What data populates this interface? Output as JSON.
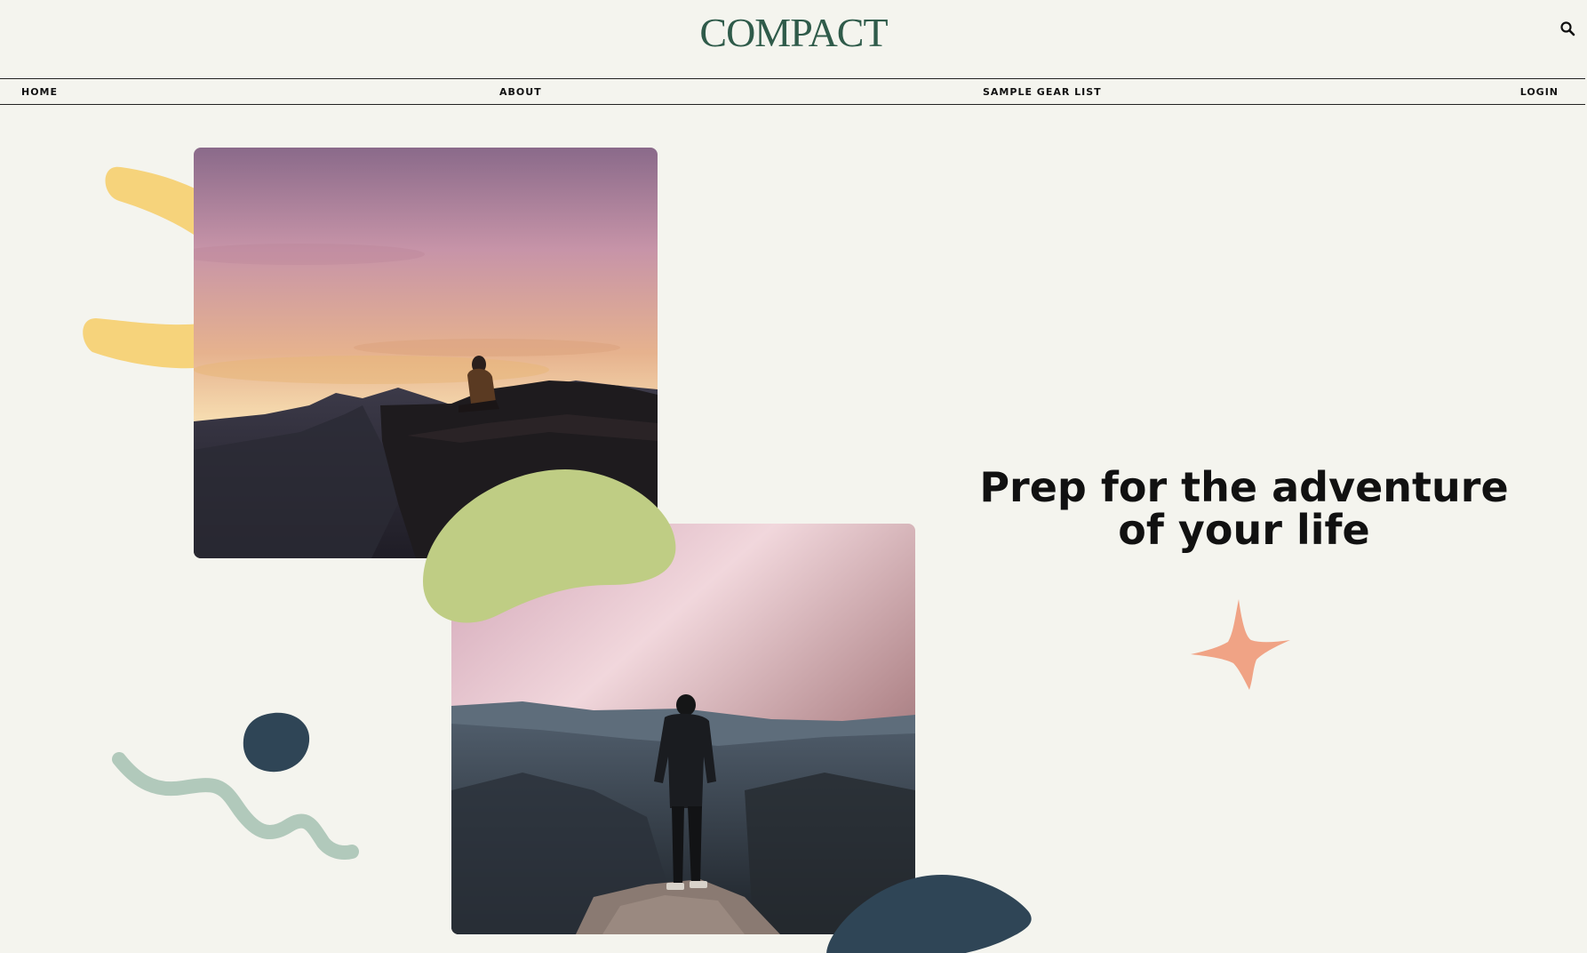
{
  "brand": {
    "name": "COMPACT",
    "color": "#2f5b4a"
  },
  "header": {
    "search_icon": "search-icon"
  },
  "nav": {
    "items": [
      {
        "label": "HOME"
      },
      {
        "label": "ABOUT"
      },
      {
        "label": "SAMPLE GEAR LIST"
      },
      {
        "label": "LOGIN"
      }
    ]
  },
  "hero": {
    "headline": "Prep for the adventure of your life",
    "images": [
      {
        "description": "person sitting on cliff edge at sunset"
      },
      {
        "description": "person standing on rock overlooking misty valley"
      }
    ]
  },
  "decorations": {
    "colors": {
      "yellow": "#f6d37b",
      "green": "#bfcd84",
      "navy": "#2f4556",
      "sage": "#b1c9bb",
      "coral": "#f0a385",
      "background": "#f4f4ee"
    }
  }
}
